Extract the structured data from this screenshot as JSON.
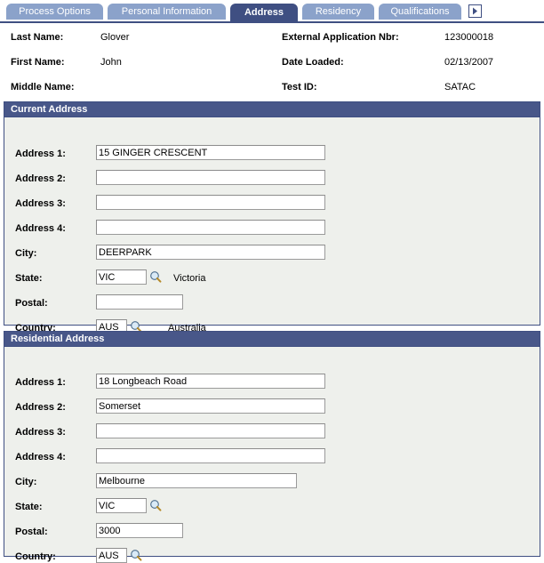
{
  "tabs": [
    {
      "label": "Process Options",
      "active": false
    },
    {
      "label": "Personal Information",
      "active": false
    },
    {
      "label": "Address",
      "active": true
    },
    {
      "label": "Residency",
      "active": false
    },
    {
      "label": "Qualifications",
      "active": false
    }
  ],
  "tab_next_icon": "next-arrow-icon",
  "header": {
    "left": [
      {
        "label": "Last Name:",
        "value": "Glover"
      },
      {
        "label": "First Name:",
        "value": "John"
      },
      {
        "label": "Middle Name:",
        "value": ""
      }
    ],
    "right": [
      {
        "label": "External Application Nbr:",
        "value": "123000018"
      },
      {
        "label": "Date Loaded:",
        "value": "02/13/2007"
      },
      {
        "label": "Test ID:",
        "value": "SATAC"
      }
    ]
  },
  "current_address": {
    "title": "Current Address",
    "fields": [
      {
        "label": "Address 1:",
        "value": "15 GINGER CRESCENT",
        "lookup": false,
        "side": ""
      },
      {
        "label": "Address 2:",
        "value": "",
        "lookup": false,
        "side": ""
      },
      {
        "label": "Address 3:",
        "value": "",
        "lookup": false,
        "side": ""
      },
      {
        "label": "Address 4:",
        "value": "",
        "lookup": false,
        "side": ""
      },
      {
        "label": "City:",
        "value": "DEERPARK",
        "lookup": false,
        "side": ""
      },
      {
        "label": "State:",
        "value": "VIC",
        "lookup": true,
        "side": "Victoria"
      },
      {
        "label": "Postal:",
        "value": "",
        "lookup": false,
        "side": ""
      },
      {
        "label": "Country:",
        "value": "AUS",
        "lookup": true,
        "side": "Australia"
      }
    ]
  },
  "residential_address": {
    "title": "Residential Address",
    "fields": [
      {
        "label": "Address 1:",
        "value": "18 Longbeach Road",
        "lookup": false,
        "side": ""
      },
      {
        "label": "Address 2:",
        "value": "Somerset",
        "lookup": false,
        "side": ""
      },
      {
        "label": "Address 3:",
        "value": "",
        "lookup": false,
        "side": ""
      },
      {
        "label": "Address 4:",
        "value": "",
        "lookup": false,
        "side": ""
      },
      {
        "label": "City:",
        "value": "Melbourne",
        "lookup": false,
        "side": ""
      },
      {
        "label": "State:",
        "value": "VIC",
        "lookup": true,
        "side": ""
      },
      {
        "label": "Postal:",
        "value": "3000",
        "lookup": false,
        "side": ""
      },
      {
        "label": "Country:",
        "value": "AUS",
        "lookup": true,
        "side": ""
      }
    ]
  },
  "colors": {
    "tab_active_bg": "#3f4f82",
    "tab_inactive_bg": "#8ba2ca",
    "group_header_bg": "#485789",
    "group_body_bg": "#eef0ec",
    "border": "#3f4f82"
  }
}
